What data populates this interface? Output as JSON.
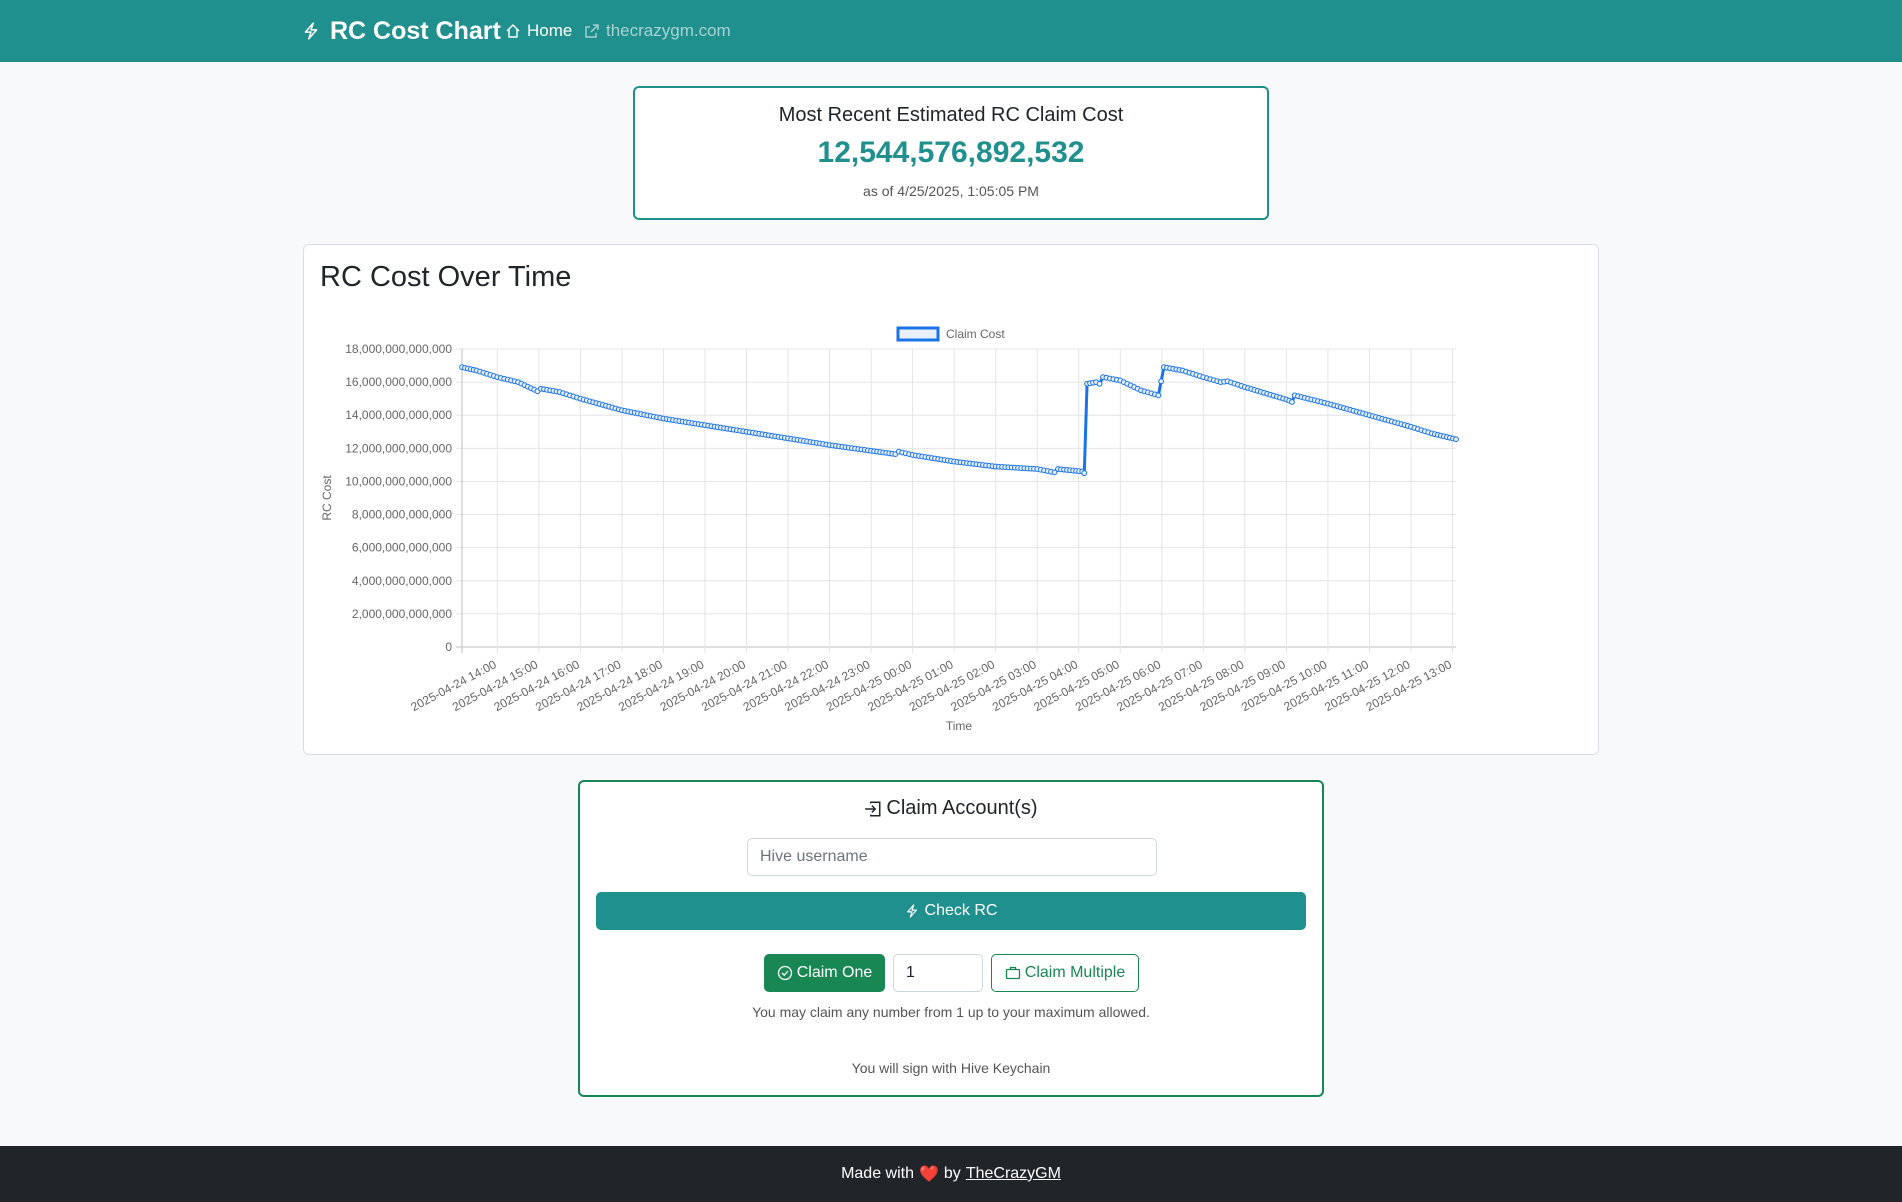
{
  "navbar": {
    "brand": "RC Cost Chart",
    "home_label": "Home",
    "external_label": "thecrazygm.com",
    "icons": {
      "brand": "lightning-icon",
      "home": "home-icon",
      "external": "external-link-icon"
    }
  },
  "cost_card": {
    "title": "Most Recent Estimated RC Claim Cost",
    "value": "12,544,576,892,532",
    "as_of": "as of 4/25/2025, 1:05:05 PM"
  },
  "chart_card": {
    "heading": "RC Cost Over Time"
  },
  "chart_data": {
    "type": "line",
    "title": "",
    "xlabel": "Time",
    "ylabel": "RC Cost",
    "legend": {
      "position": "top",
      "entries": [
        "Claim Cost"
      ]
    },
    "grid": true,
    "ylim": [
      0,
      18000000000000
    ],
    "y_ticks": [
      0,
      2000000000000,
      4000000000000,
      6000000000000,
      8000000000000,
      10000000000000,
      12000000000000,
      14000000000000,
      16000000000000,
      18000000000000
    ],
    "y_tick_labels": [
      "0",
      "2,000,000,000,000",
      "4,000,000,000,000",
      "6,000,000,000,000",
      "8,000,000,000,000",
      "10,000,000,000,000",
      "12,000,000,000,000",
      "14,000,000,000,000",
      "16,000,000,000,000",
      "18,000,000,000,000"
    ],
    "x_tick_labels": [
      "2025-04-24 14:00",
      "2025-04-24 15:00",
      "2025-04-24 16:00",
      "2025-04-24 17:00",
      "2025-04-24 18:00",
      "2025-04-24 19:00",
      "2025-04-24 20:00",
      "2025-04-24 21:00",
      "2025-04-24 22:00",
      "2025-04-24 23:00",
      "2025-04-25 00:00",
      "2025-04-25 01:00",
      "2025-04-25 02:00",
      "2025-04-25 03:00",
      "2025-04-25 04:00",
      "2025-04-25 05:00",
      "2025-04-25 06:00",
      "2025-04-25 07:00",
      "2025-04-25 08:00",
      "2025-04-25 09:00",
      "2025-04-25 10:00",
      "2025-04-25 11:00",
      "2025-04-25 12:00",
      "2025-04-25 13:00"
    ],
    "xlim": [
      "2025-04-24 13:09",
      "2025-04-25 13:05"
    ],
    "series": [
      {
        "name": "Claim Cost",
        "color": "#1a73e8",
        "points": [
          [
            "2025-04-24 13:09",
            16900000000000
          ],
          [
            "2025-04-24 13:30",
            16700000000000
          ],
          [
            "2025-04-24 14:00",
            16300000000000
          ],
          [
            "2025-04-24 14:30",
            16000000000000
          ],
          [
            "2025-04-24 14:58",
            15450000000000
          ],
          [
            "2025-04-24 15:03",
            15600000000000
          ],
          [
            "2025-04-24 15:30",
            15400000000000
          ],
          [
            "2025-04-24 16:00",
            15000000000000
          ],
          [
            "2025-04-24 17:00",
            14300000000000
          ],
          [
            "2025-04-24 18:00",
            13800000000000
          ],
          [
            "2025-04-24 19:00",
            13400000000000
          ],
          [
            "2025-04-24 20:00",
            13000000000000
          ],
          [
            "2025-04-24 21:00",
            12600000000000
          ],
          [
            "2025-04-24 22:00",
            12200000000000
          ],
          [
            "2025-04-24 23:00",
            11850000000000
          ],
          [
            "2025-04-24 23:35",
            11650000000000
          ],
          [
            "2025-04-24 23:40",
            11800000000000
          ],
          [
            "2025-04-25 00:00",
            11600000000000
          ],
          [
            "2025-04-25 01:00",
            11200000000000
          ],
          [
            "2025-04-25 02:00",
            10900000000000
          ],
          [
            "2025-04-25 03:00",
            10750000000000
          ],
          [
            "2025-04-25 03:25",
            10550000000000
          ],
          [
            "2025-04-25 03:30",
            10750000000000
          ],
          [
            "2025-04-25 04:05",
            10600000000000
          ],
          [
            "2025-04-25 04:08",
            10500000000000
          ],
          [
            "2025-04-25 04:12",
            15900000000000
          ],
          [
            "2025-04-25 04:25",
            16000000000000
          ],
          [
            "2025-04-25 04:30",
            15900000000000
          ],
          [
            "2025-04-25 04:35",
            16300000000000
          ],
          [
            "2025-04-25 05:00",
            16100000000000
          ],
          [
            "2025-04-25 05:30",
            15500000000000
          ],
          [
            "2025-04-25 05:55",
            15200000000000
          ],
          [
            "2025-04-25 06:03",
            16900000000000
          ],
          [
            "2025-04-25 06:30",
            16700000000000
          ],
          [
            "2025-04-25 07:00",
            16300000000000
          ],
          [
            "2025-04-25 07:25",
            16000000000000
          ],
          [
            "2025-04-25 07:35",
            16050000000000
          ],
          [
            "2025-04-25 08:00",
            15700000000000
          ],
          [
            "2025-04-25 09:00",
            14950000000000
          ],
          [
            "2025-04-25 09:08",
            14800000000000
          ],
          [
            "2025-04-25 09:12",
            15200000000000
          ],
          [
            "2025-04-25 10:00",
            14700000000000
          ],
          [
            "2025-04-25 11:00",
            14000000000000
          ],
          [
            "2025-04-25 12:00",
            13300000000000
          ],
          [
            "2025-04-25 12:30",
            12900000000000
          ],
          [
            "2025-04-25 13:05",
            12550000000000
          ]
        ]
      }
    ]
  },
  "claim_card": {
    "title": "Claim Account(s)",
    "username_placeholder": "Hive username",
    "username_value": "",
    "check_label": "Check RC",
    "claim_one_label": "Claim One",
    "quantity_value": "1",
    "claim_multiple_label": "Claim Multiple",
    "hint": "You may claim any number from 1 up to your maximum allowed.",
    "keychain_note": "You will sign with Hive Keychain",
    "icons": {
      "title": "sign-in-icon",
      "check": "lightning-icon",
      "claim_one": "check-circle-icon",
      "claim_multiple": "briefcase-icon"
    }
  },
  "footer": {
    "made_with": "Made with",
    "heart": "❤️",
    "by": "by",
    "author": "TheCrazyGM"
  },
  "colors": {
    "primary": "#20908e",
    "success": "#198754",
    "line": "#1a73e8",
    "footer": "#212529"
  }
}
